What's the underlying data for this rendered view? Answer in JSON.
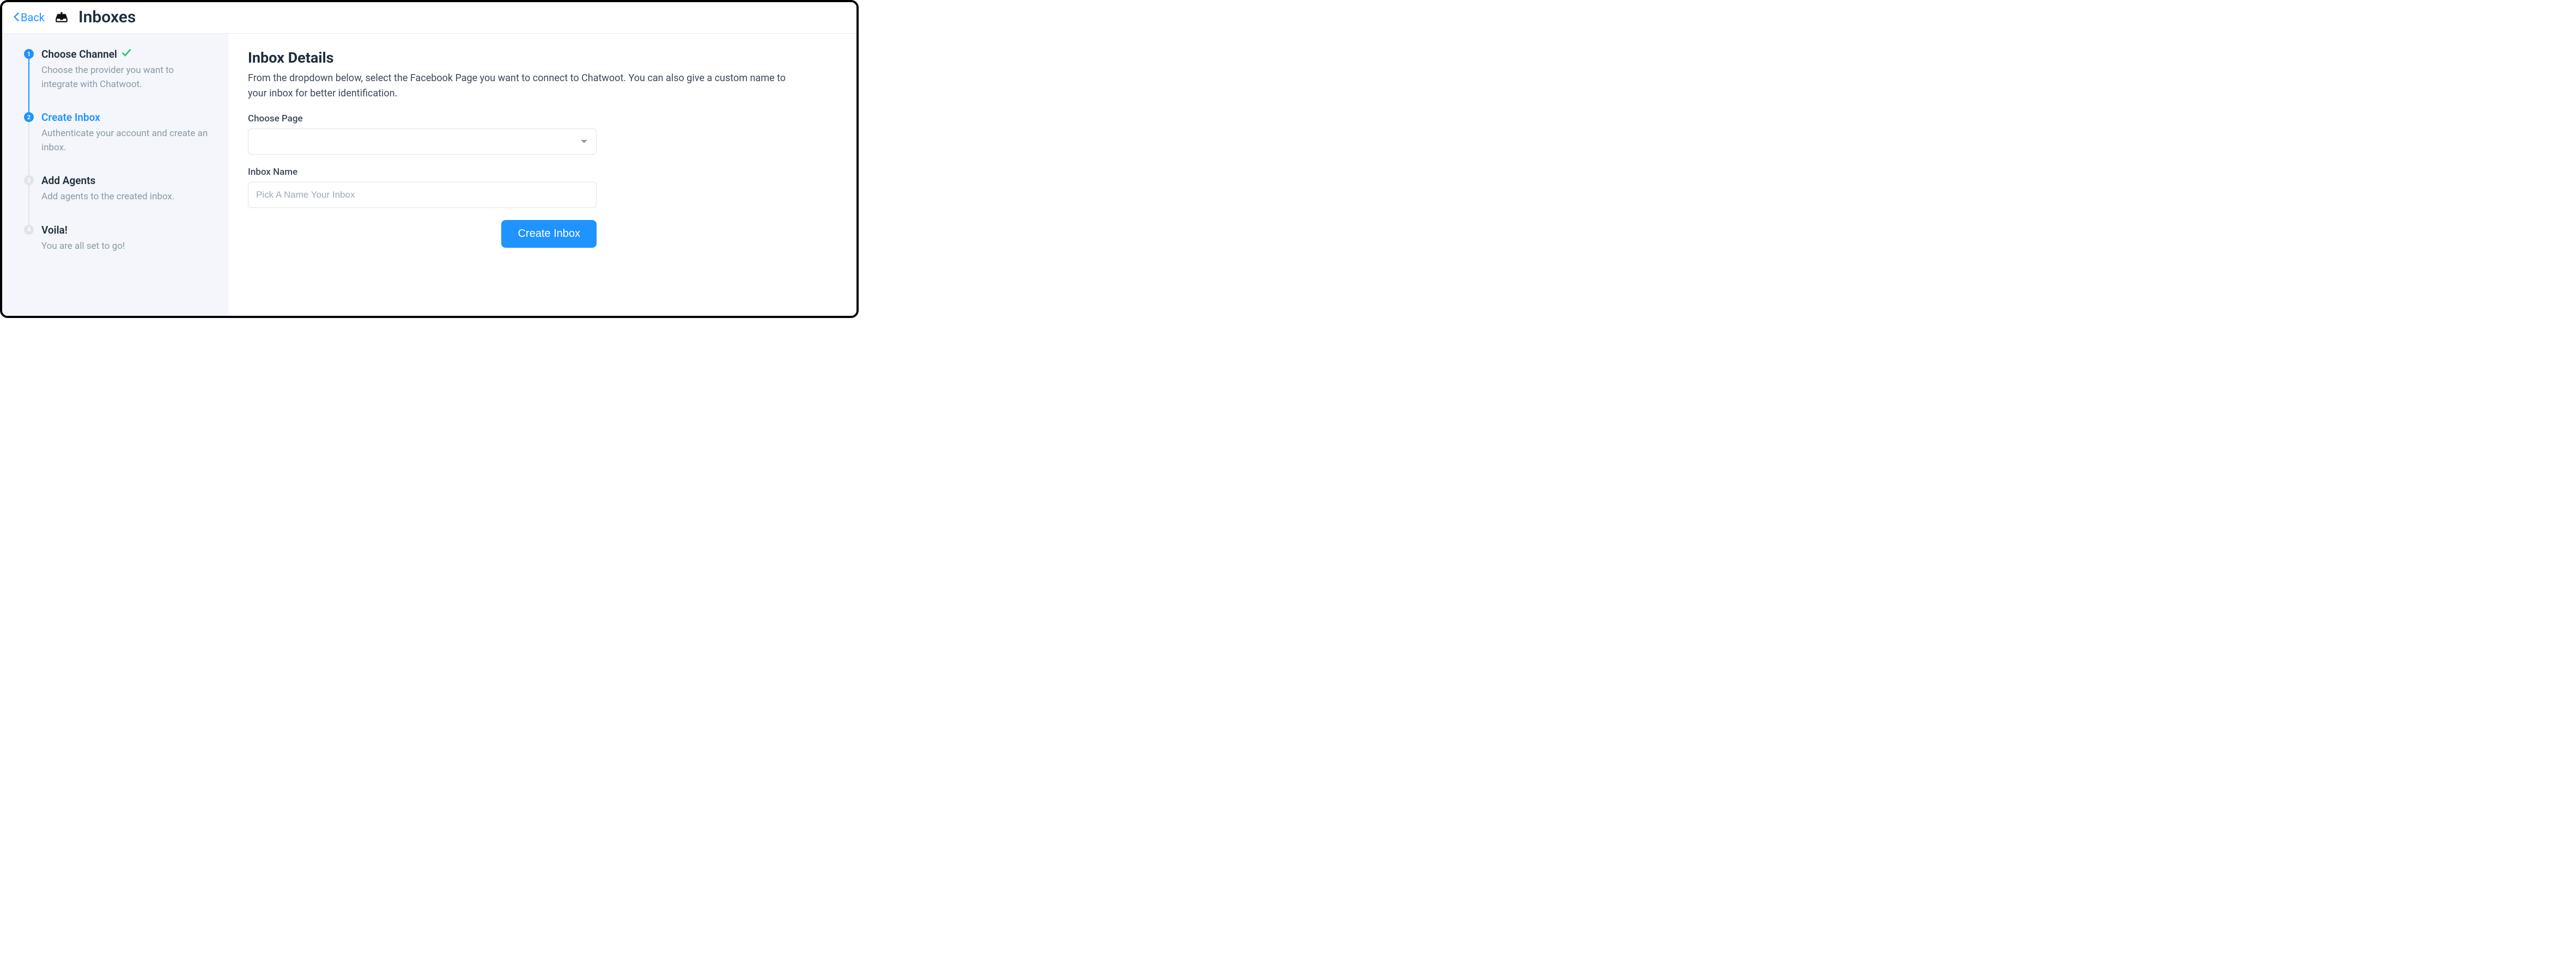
{
  "header": {
    "back_label": "Back",
    "title": "Inboxes"
  },
  "steps": [
    {
      "num": "1",
      "title": "Choose Channel",
      "desc": "Choose the provider you want to integrate with Chatwoot.",
      "state": "done"
    },
    {
      "num": "2",
      "title": "Create Inbox",
      "desc": "Authenticate your account and create an inbox.",
      "state": "active"
    },
    {
      "num": "3",
      "title": "Add Agents",
      "desc": "Add agents to the created inbox.",
      "state": "pending"
    },
    {
      "num": "4",
      "title": "Voila!",
      "desc": "You are all set to go!",
      "state": "pending"
    }
  ],
  "main": {
    "title": "Inbox Details",
    "desc": "From the dropdown below, select the Facebook Page you want to connect to Chatwoot. You can also give a custom name to your inbox for better identification.",
    "choose_page_label": "Choose Page",
    "choose_page_value": "",
    "inbox_name_label": "Inbox Name",
    "inbox_name_placeholder": "Pick A Name Your Inbox",
    "submit_label": "Create Inbox"
  }
}
